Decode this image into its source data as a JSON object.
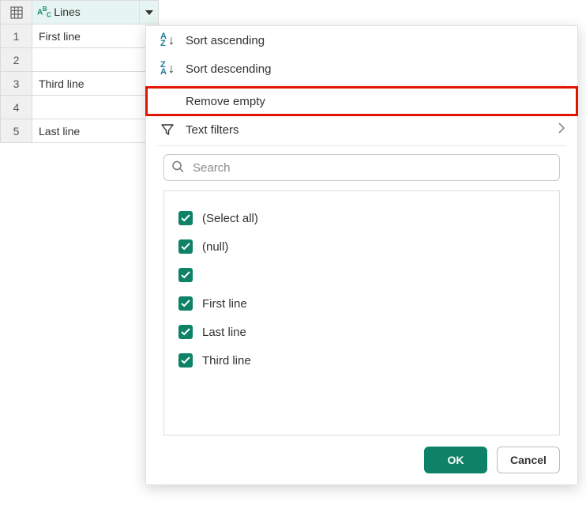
{
  "column": {
    "name": "Lines",
    "type_label": "ABC"
  },
  "rows": [
    {
      "num": "1",
      "value": "First line"
    },
    {
      "num": "2",
      "value": ""
    },
    {
      "num": "3",
      "value": "Third line"
    },
    {
      "num": "4",
      "value": ""
    },
    {
      "num": "5",
      "value": "Last line"
    }
  ],
  "menu": {
    "sort_asc": "Sort ascending",
    "sort_desc": "Sort descending",
    "remove_empty": "Remove empty",
    "text_filters": "Text filters"
  },
  "search": {
    "placeholder": "Search"
  },
  "filter_values": [
    {
      "label": "(Select all)",
      "checked": true
    },
    {
      "label": "(null)",
      "checked": true
    },
    {
      "label": "",
      "checked": true
    },
    {
      "label": "First line",
      "checked": true
    },
    {
      "label": "Last line",
      "checked": true
    },
    {
      "label": "Third line",
      "checked": true
    }
  ],
  "buttons": {
    "ok": "OK",
    "cancel": "Cancel"
  },
  "highlight": "remove_empty"
}
